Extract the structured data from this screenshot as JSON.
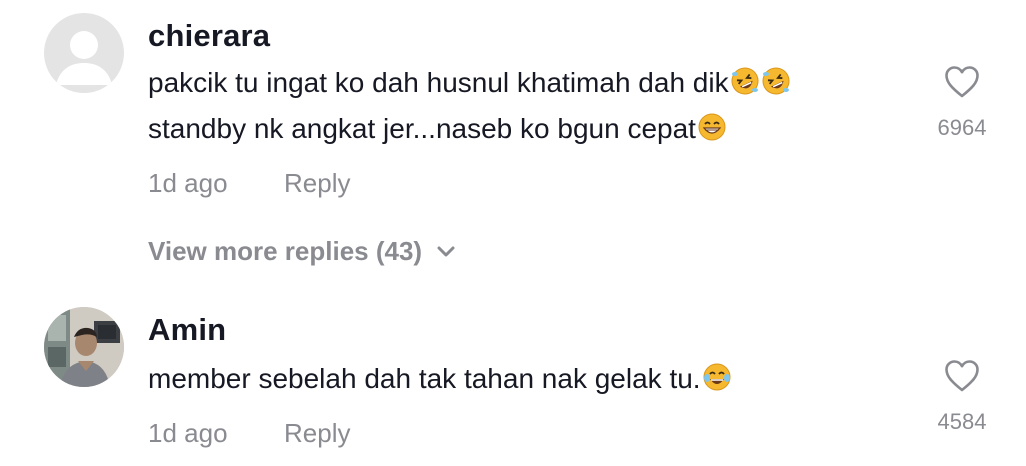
{
  "comments": [
    {
      "username": "chierara",
      "lines": [
        "pakcik tu ingat ko dah husnul khatimah dah dik",
        "standby nk angkat jer...naseb ko bgun cepat"
      ],
      "line_emojis": [
        [
          "rolling-on-floor-laughing-emoji",
          "rolling-on-floor-laughing-emoji"
        ],
        [
          "grinning-face-emoji"
        ]
      ],
      "time": "1d ago",
      "reply_label": "Reply",
      "likes": "6964",
      "avatar_icon": "default-user-avatar-icon"
    },
    {
      "username": "Amin",
      "lines": [
        "member sebelah dah tak tahan nak gelak tu."
      ],
      "line_emojis": [
        [
          "face-with-tears-of-joy-emoji"
        ]
      ],
      "time": "1d ago",
      "reply_label": "Reply",
      "likes": "4584",
      "avatar_icon": "profile-photo-avatar"
    }
  ],
  "view_more": {
    "label": "View more replies (43)",
    "icon": "chevron-down-icon"
  },
  "like_icon": "heart-outline-icon",
  "colors": {
    "text": "#161823",
    "secondary": "#8a8b91",
    "emoji": "#f5b82e"
  }
}
